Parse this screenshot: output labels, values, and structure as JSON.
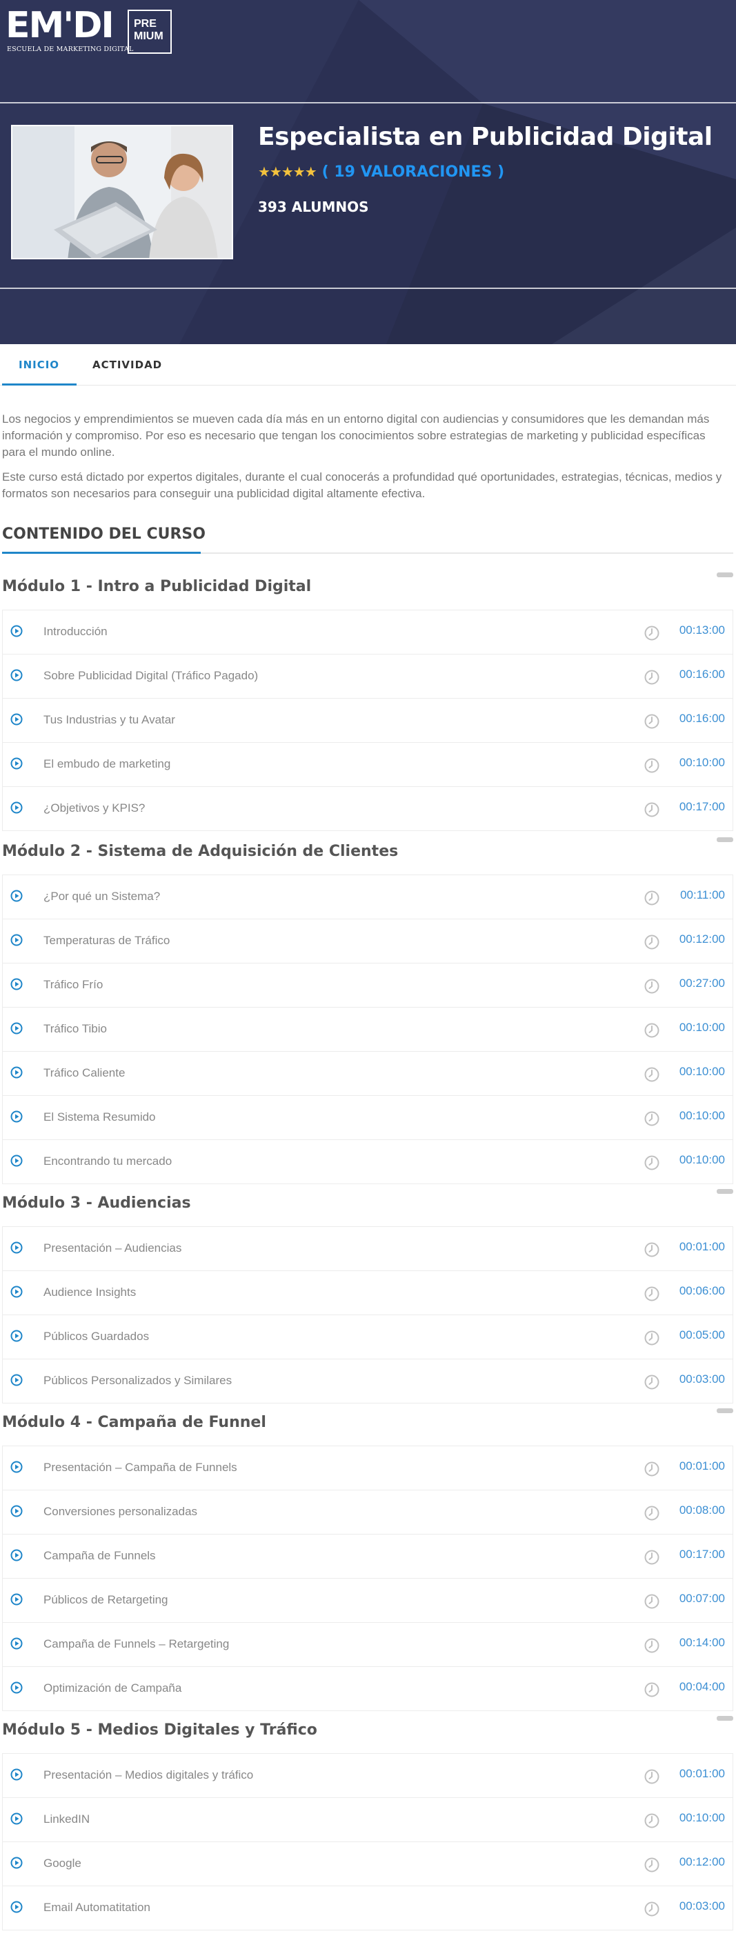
{
  "logo": {
    "mark": "EM'DI",
    "tagline": "ESCUELA DE MARKETING DIGITAL",
    "badge_line1": "PRE",
    "badge_line2": "MIUM"
  },
  "course": {
    "title": "Especialista en Publicidad Digital",
    "stars": "★★★★★",
    "ratings": "( 19 VALORACIONES )",
    "students": "393 ALUMNOS"
  },
  "tabs": [
    {
      "label": "INICIO"
    },
    {
      "label": "ACTIVIDAD"
    }
  ],
  "description": [
    "Los negocios y emprendimientos se mueven cada día más en un entorno digital con audiencias y consumidores que les demandan más información y compromiso. Por eso es necesario que tengan los conocimientos sobre estrategias de marketing y publicidad específicas para el mundo online.",
    "Este curso está dictado por expertos digitales, durante el cual conocerás a profundidad qué oportunidades, estrategias, técnicas, medios y formatos son necesarios para conseguir una publicidad digital altamente efectiva."
  ],
  "content_title": "CONTENIDO DEL CURSO",
  "modules": [
    {
      "title": "Módulo 1 - Intro a Publicidad Digital",
      "lessons": [
        {
          "name": "Introducción",
          "duration": "00:13:00"
        },
        {
          "name": "Sobre Publicidad Digital (Tráfico Pagado)",
          "duration": "00:16:00"
        },
        {
          "name": "Tus Industrias y tu Avatar",
          "duration": "00:16:00"
        },
        {
          "name": "El embudo de marketing",
          "duration": "00:10:00"
        },
        {
          "name": "¿Objetivos y KPIS?",
          "duration": "00:17:00"
        }
      ]
    },
    {
      "title": "Módulo 2 - Sistema de Adquisición de Clientes",
      "lessons": [
        {
          "name": "¿Por qué un Sistema?",
          "duration": "00:11:00"
        },
        {
          "name": "Temperaturas de Tráfico",
          "duration": "00:12:00"
        },
        {
          "name": "Tráfico Frío",
          "duration": "00:27:00"
        },
        {
          "name": "Tráfico Tibio",
          "duration": "00:10:00"
        },
        {
          "name": "Tráfico Caliente",
          "duration": "00:10:00"
        },
        {
          "name": "El Sistema Resumido",
          "duration": "00:10:00"
        },
        {
          "name": "Encontrando tu mercado",
          "duration": "00:10:00"
        }
      ]
    },
    {
      "title": "Módulo 3 - Audiencias",
      "lessons": [
        {
          "name": "Presentación – Audiencias",
          "duration": "00:01:00"
        },
        {
          "name": "Audience Insights",
          "duration": "00:06:00"
        },
        {
          "name": "Públicos Guardados",
          "duration": "00:05:00"
        },
        {
          "name": "Públicos Personalizados y Similares",
          "duration": "00:03:00"
        }
      ]
    },
    {
      "title": "Módulo 4 - Campaña de Funnel",
      "lessons": [
        {
          "name": "Presentación – Campaña de Funnels",
          "duration": "00:01:00"
        },
        {
          "name": "Conversiones personalizadas",
          "duration": "00:08:00"
        },
        {
          "name": "Campaña de Funnels",
          "duration": "00:17:00"
        },
        {
          "name": "Públicos de Retargeting",
          "duration": "00:07:00"
        },
        {
          "name": "Campaña de Funnels – Retargeting",
          "duration": "00:14:00"
        },
        {
          "name": "Optimización de Campaña",
          "duration": "00:04:00"
        }
      ]
    },
    {
      "title": "Módulo 5 - Medios Digitales y Tráfico",
      "lessons": [
        {
          "name": "Presentación – Medios digitales y tráfico",
          "duration": "00:01:00"
        },
        {
          "name": "LinkedIN",
          "duration": "00:10:00"
        },
        {
          "name": "Google",
          "duration": "00:12:00"
        },
        {
          "name": "Email Automatitation",
          "duration": "00:03:00"
        }
      ]
    }
  ],
  "colors": {
    "hero_bg": "#2c3152",
    "accent": "#1f86c9",
    "rating": "#2196f3",
    "stars": "#f4c23d"
  }
}
